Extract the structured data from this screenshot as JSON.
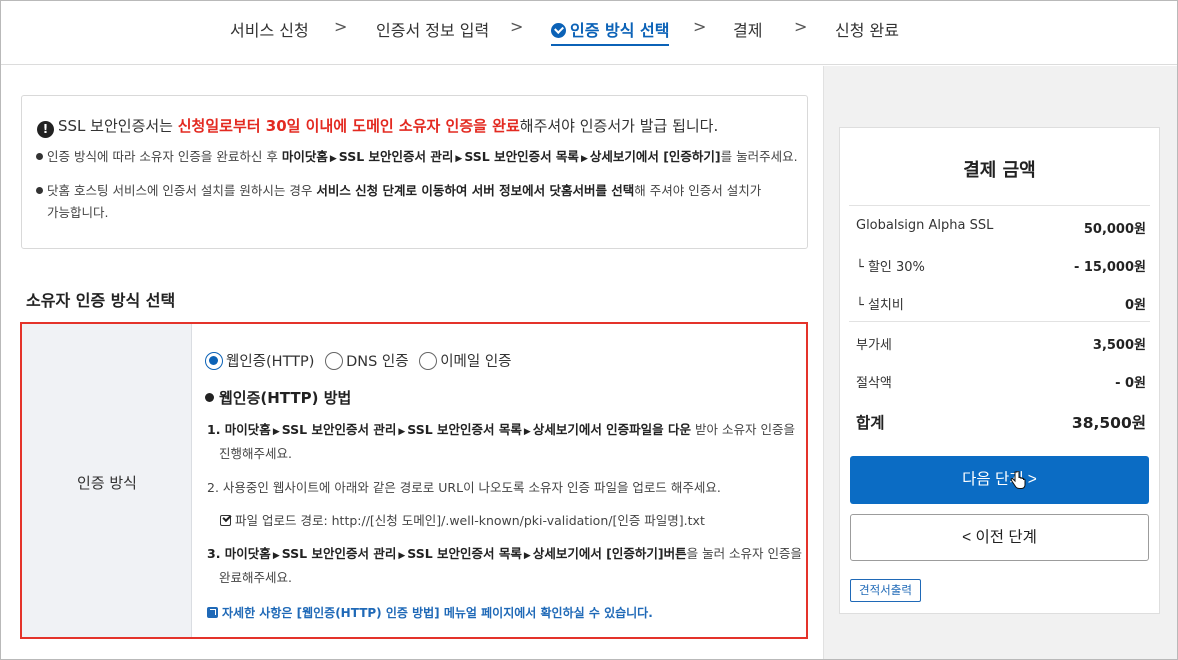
{
  "stepper": {
    "steps": [
      {
        "label": "서비스 신청",
        "active": false
      },
      {
        "label": "인증서 정보 입력",
        "active": false
      },
      {
        "label": "인증 방식 선택",
        "active": true
      },
      {
        "label": "결제",
        "active": false
      },
      {
        "label": "신청 완료",
        "active": false
      }
    ],
    "separator": ">"
  },
  "notice": {
    "main_prefix": "SSL 보안인증서는 ",
    "main_highlight": "신청일로부터 30일 이내에 도메인 소유자 인증을 완료",
    "main_suffix": "해주셔야 인증서가 발급 됩니다.",
    "line1_prefix": "인증 방식에 따라 소유자 인증을 완료하신 후 ",
    "line1_path": [
      "마이닷홈",
      "SSL 보안인증서 관리",
      "SSL 보안인증서 목록",
      "상세보기에서 [인증하기]"
    ],
    "line1_suffix": "를 눌러주세요.",
    "line2_prefix": "닷홈 호스팅 서비스에 인증서 설치를 원하시는 경우 ",
    "line2_bold": "서비스 신청 단계로 이동하여 서버 정보에서 닷홈서버를 선택",
    "line2_suffix": "해 주셔야 인증서 설치가",
    "line2_cont": "가능합니다."
  },
  "section_title": "소유자 인증 방식 선택",
  "method": {
    "label": "인증 방식",
    "options": [
      {
        "label": "웹인증(HTTP)",
        "checked": true
      },
      {
        "label": "DNS 인증",
        "checked": false
      },
      {
        "label": "이메일 인증",
        "checked": false
      }
    ],
    "heading": "웹인증(HTTP) 방법",
    "step1_path": [
      "1. 마이닷홈",
      "SSL 보안인증서 관리",
      "SSL 보안인증서 목록",
      "상세보기에서 인증파일을 다운"
    ],
    "step1_suffix": " 받아 소유자 인증을",
    "step1_cont": "진행해주세요.",
    "step2": "2. 사용중인 웹사이트에 아래와 같은 경로로 URL이 나오도록 소유자 인증 파일을 업로드 해주세요.",
    "upload_path": "파일 업로드 경로: http://[신청 도메인]/.well-known/pki-validation/[인증 파일명].txt",
    "step3_path": [
      "3. 마이닷홈",
      "SSL 보안인증서 관리",
      "SSL 보안인증서 목록",
      "상세보기에서 [인증하기]버튼"
    ],
    "step3_suffix": "을 눌러 소유자 인증을",
    "step3_cont": "완료해주세요.",
    "manual_link": "자세한 사항은 [웹인증(HTTP) 인증 방법] 메뉴얼 페이지에서 확인하실 수 있습니다."
  },
  "payment": {
    "title": "결제 금액",
    "rows": [
      {
        "label": "Globalsign Alpha SSL",
        "value": "50,000원"
      },
      {
        "label": "└ 할인 30%",
        "value": "- 15,000원"
      },
      {
        "label": "└ 설치비",
        "value": "0원"
      },
      {
        "label": "부가세",
        "value": "3,500원"
      },
      {
        "label": "절삭액",
        "value": "- 0원"
      }
    ],
    "total_label": "합계",
    "total_value": "38,500원",
    "next_button": "다음 단계 >",
    "prev_button": "< 이전 단계",
    "quote_button": "견적서출력"
  },
  "colors": {
    "accent": "#0b62b7",
    "highlight_red": "#e32a21",
    "frame_red": "#e4332a",
    "next_button": "#0b6cc4"
  }
}
